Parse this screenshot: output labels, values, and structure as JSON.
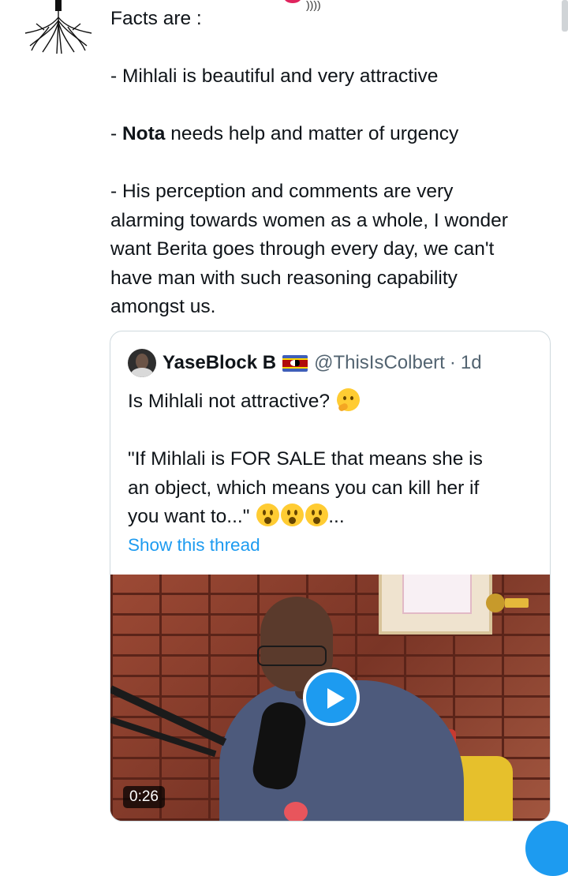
{
  "tweet": {
    "paragraphs": {
      "p1": "Facts are :",
      "p2": "- Mihlali is beautiful and very attractive",
      "p3_prefix": "- ",
      "p3_bold": "Nota",
      "p3_rest": " needs help and matter of urgency",
      "p4_lines": [
        "- His perception and comments are very",
        "alarming towards women as a whole, I wonder",
        "want Berita goes through every day, we can't",
        "have man with such reasoning capability",
        "amongst us."
      ]
    }
  },
  "quote": {
    "name": "YaseBlock B",
    "flag_icon": "eswatini-flag-icon",
    "handle": "@ThisIsColbert",
    "separator": "·",
    "time": "1d",
    "line1": "Is Mihlali not attractive?",
    "line1_emoji": "thinking-face-icon",
    "line2a": "\"If Mihlali is FOR SALE that means she is",
    "line2b": "an object, which means you can kill her if",
    "line2c": "you want to...\"",
    "line2_emoji": "face-with-open-mouth-icon",
    "ellipsis": "...",
    "show_thread": "Show this thread",
    "video": {
      "duration": "0:26",
      "play_icon": "play-icon"
    }
  },
  "colors": {
    "accent": "#1d9bf0",
    "text": "#0f1419",
    "muted": "#536471",
    "border": "#cfd9de"
  }
}
